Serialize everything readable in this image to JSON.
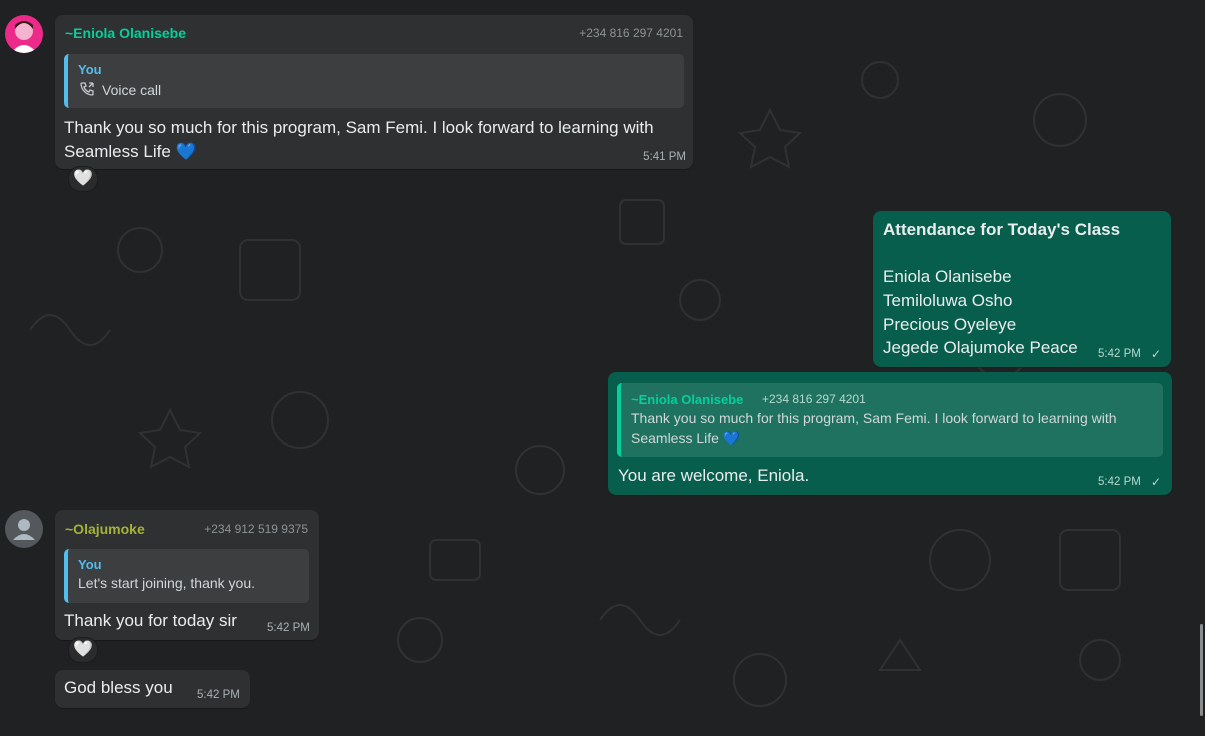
{
  "messages": {
    "m1": {
      "sender": "~Eniola Olanisebe",
      "phone": "+234 816 297 4201",
      "quote_author": "You",
      "quote_text": "Voice call",
      "text_line1": "Thank you so much for this program, Sam Femi. I look forward to learning with",
      "text_line2": "Seamless Life 💙",
      "time": "5:41 PM",
      "reaction": "🤍"
    },
    "m2": {
      "title": "Attendance for Today's Class",
      "names": [
        "Eniola Olanisebe",
        "Temiloluwa Osho",
        "Precious Oyeleye",
        "Jegede Olajumoke Peace"
      ],
      "time": "5:42 PM",
      "tick": "✓"
    },
    "m3": {
      "quote_author": "~Eniola Olanisebe",
      "quote_phone": "+234 816 297 4201",
      "quote_line1": "Thank you so much for this program, Sam Femi. I look forward to learning with",
      "quote_line2": "Seamless Life 💙",
      "text": "You are welcome, Eniola.",
      "time": "5:42 PM",
      "tick": "✓"
    },
    "m4": {
      "sender": "~Olajumoke",
      "phone": "+234 912 519 9375",
      "quote_author": "You",
      "quote_text": "Let's start joining, thank you.",
      "text": "Thank you for today sir",
      "time": "5:42 PM",
      "reaction": "🤍"
    },
    "m5": {
      "text": "God bless you",
      "time": "5:42 PM"
    }
  },
  "colors": {
    "sender1": "#06cf9c",
    "sender2": "#a5b337",
    "quote_you": "#53bdeb",
    "outgoing_bubble": "#075e4c",
    "incoming_bubble": "#2f3031"
  },
  "icons": {
    "voice_call": "phone-call-icon",
    "read_tick": "check-icon",
    "generic_avatar": "user-silhouette-icon"
  }
}
